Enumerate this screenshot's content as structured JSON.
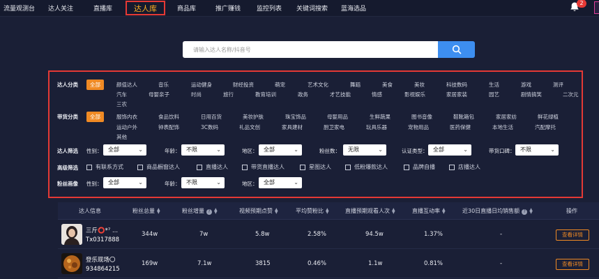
{
  "nav": {
    "items": [
      {
        "label": "流量观测台"
      },
      {
        "label": "达人关注"
      },
      {
        "label": "直播库"
      },
      {
        "label": "达人库"
      },
      {
        "label": "商品库"
      },
      {
        "label": "推广赚钱"
      },
      {
        "label": "监控列表"
      },
      {
        "label": "关键词搜索"
      },
      {
        "label": "蓝海选品"
      }
    ],
    "active_index": 3,
    "notification_count": "2"
  },
  "search": {
    "placeholder": "请输入达人名称/抖音号",
    "icon": "search-icon"
  },
  "filters": {
    "category": {
      "label": "达人分类",
      "options": [
        "全部",
        "颜值达人",
        "音乐",
        "运动健身",
        "财经投资",
        "萌宠",
        "艺术文化",
        "舞蹈",
        "美食",
        "美妆",
        "科技数码",
        "生活",
        "游戏",
        "测评",
        "汽车",
        "母婴亲子",
        "时尚",
        "旅行",
        "教育培训",
        "政务",
        "才艺技能",
        "情感",
        "影视娱乐",
        "家居家装",
        "园艺",
        "剧情搞笑",
        "二次元",
        "三农"
      ],
      "selected": "全部"
    },
    "goods": {
      "label": "带货分类",
      "options": [
        "全部",
        "服饰内衣",
        "食品饮料",
        "日用百货",
        "美妆护肤",
        "珠宝饰品",
        "母婴用品",
        "生鲜蔬果",
        "图书音像",
        "鞋靴箱包",
        "家居家纺",
        "鲜花绿植",
        "运动户外",
        "钟表配饰",
        "3C数码",
        "礼品文创",
        "家具建材",
        "厨卫家电",
        "玩具乐器",
        "宠物用品",
        "医药保健",
        "本地生活",
        "汽配摩托",
        "其他"
      ],
      "selected": "全部"
    },
    "screen": {
      "label": "达人筛选",
      "gender_label": "性别：",
      "gender_value": "全部",
      "age_label": "年龄：",
      "age_value": "不限",
      "region_label": "地区：",
      "region_value": "全部",
      "fans_label": "粉丝数：",
      "fans_value": "无限",
      "verify_label": "认证类型：",
      "verify_value": "全部",
      "reputation_label": "带货口碑：",
      "reputation_value": "不限"
    },
    "advanced": {
      "label": "高级筛选",
      "options": [
        "有联系方式",
        "商品橱窗达人",
        "直播达人",
        "带货直播达人",
        "星图达人",
        "低粉爆款达人",
        "品牌自播",
        "店播达人"
      ]
    },
    "fans_profile": {
      "label": "粉丝画像",
      "gender_label": "性别：",
      "gender_value": "全部",
      "age_label": "年龄：",
      "age_value": "不限",
      "region_label": "地区：",
      "region_value": "全部"
    }
  },
  "table": {
    "headers": [
      "达人信息",
      "粉丝总量",
      "粉丝增量",
      "视频预期点赞",
      "平均赞粉比",
      "直播预期观看人次",
      "直播互动率",
      "近30日直播日均销售额",
      "操作"
    ],
    "rows": [
      {
        "name": "三斤⭕*⁷ ...",
        "uid": "Tx0317888",
        "fans": "344w",
        "growth": "7w",
        "likes": "5.8w",
        "ratio": "2.58%",
        "viewers": "94.5w",
        "interaction": "1.37%",
        "sales": "-",
        "action": "查看详情"
      },
      {
        "name": "登乐现场〇",
        "uid": "934864215",
        "fans": "169w",
        "growth": "7.1w",
        "likes": "3815",
        "ratio": "0.46%",
        "viewers": "1.1w",
        "interaction": "0.81%",
        "sales": "-",
        "action": "查看详情"
      }
    ]
  }
}
